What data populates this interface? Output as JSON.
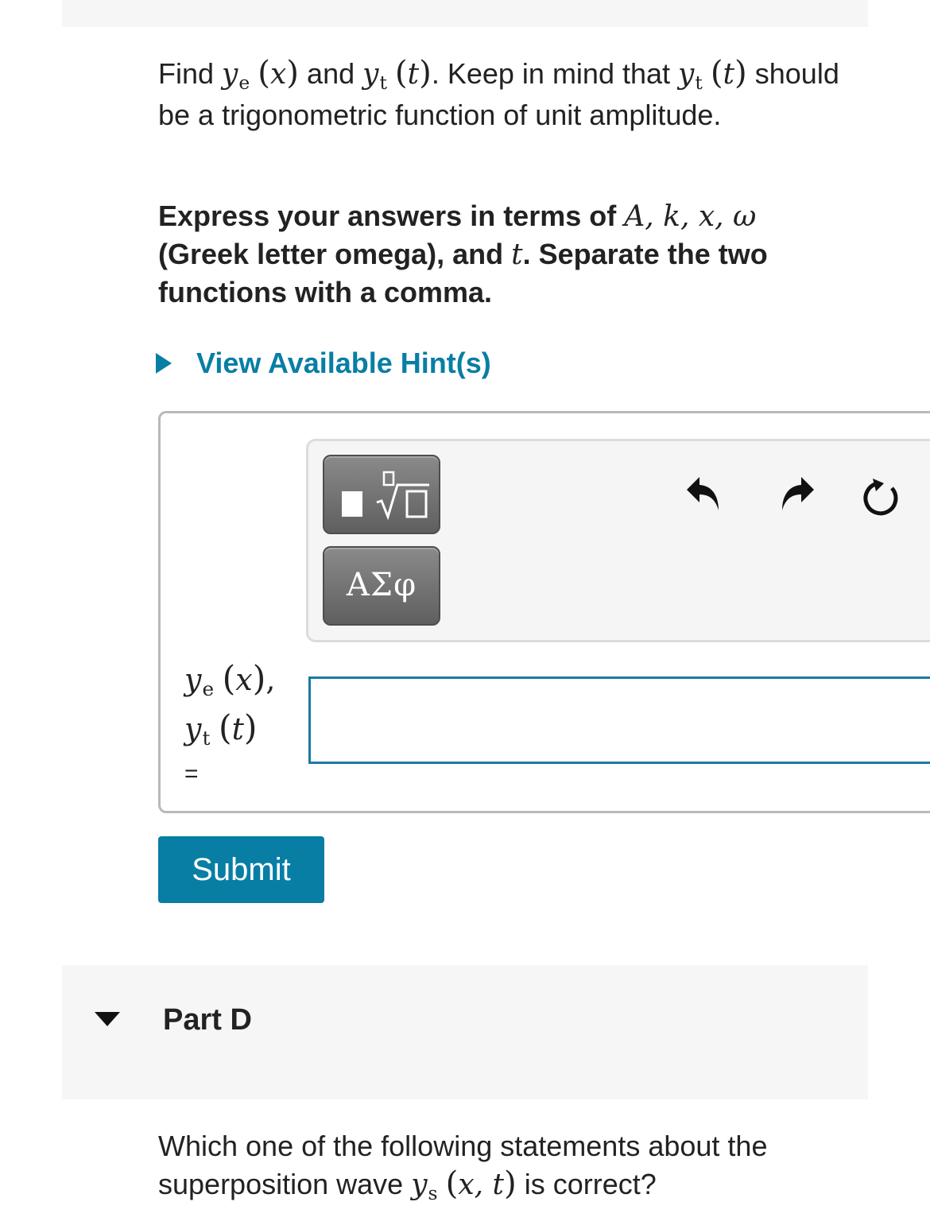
{
  "question": {
    "find_word": "Find",
    "ye_main": "y",
    "ye_sub": "e",
    "x_var": "x",
    "and_word": "and",
    "yt_main": "y",
    "yt_sub": "t",
    "t_var": "t",
    "keep_in_mind": ". Keep in mind that",
    "tail": "should be a trigonometric function of unit amplitude."
  },
  "instruction": {
    "text1": "Express your answers in terms of",
    "vars": "A, k, x, ω",
    "text2": "(Greek letter omega), and",
    "t_var": "t",
    "text3": ". Separate the two functions with a comma."
  },
  "hint": {
    "label": "View Available Hint(s)"
  },
  "toolbar": {
    "greek_button": "ΑΣφ",
    "icons": [
      "templates-icon",
      "undo-icon",
      "redo-icon",
      "reset-icon"
    ]
  },
  "answer": {
    "label_ye_main": "y",
    "label_ye_sub": "e",
    "label_x": "x",
    "label_yt_main": "y",
    "label_yt_sub": "t",
    "label_t": "t",
    "equals": "=",
    "value": ""
  },
  "submit": {
    "label": "Submit"
  },
  "part_d": {
    "title": "Part D",
    "q_text": "Which one of the following statements about the superposition wave",
    "ys_main": "y",
    "ys_sub": "s",
    "args": "x, t",
    "q_end": "is correct?"
  }
}
